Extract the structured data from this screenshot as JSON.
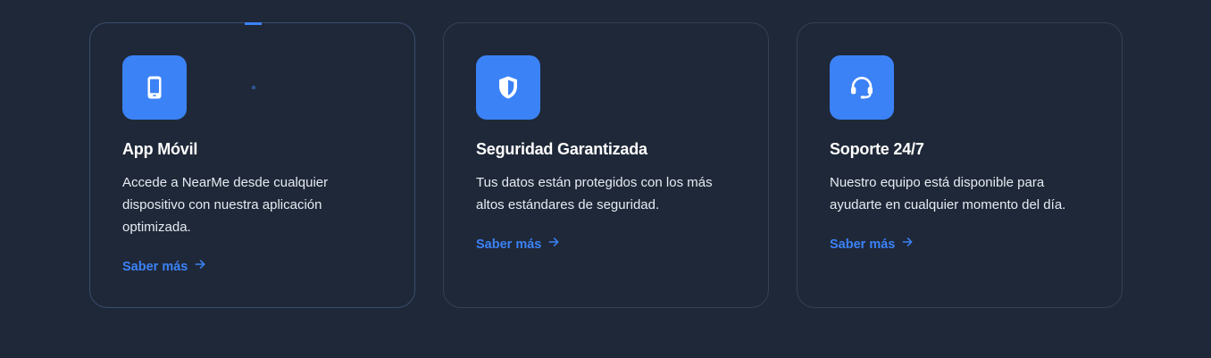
{
  "colors": {
    "background": "#1f2838",
    "accent": "#3b82f6",
    "card_border": "#334056",
    "title": "#ffffff",
    "text": "#e6ebf3"
  },
  "cards": [
    {
      "icon": "smartphone-icon",
      "title": "App Móvil",
      "description": "Accede a NearMe desde cualquier dispositivo con nuestra aplicación optimizada.",
      "link_label": "Saber más",
      "link_icon": "arrow-right-icon"
    },
    {
      "icon": "shield-icon",
      "title": "Seguridad Garantizada",
      "description": "Tus datos están protegidos con los más altos estándares de seguridad.",
      "link_label": "Saber más",
      "link_icon": "arrow-right-icon"
    },
    {
      "icon": "headset-icon",
      "title": "Soporte 24/7",
      "description": "Nuestro equipo está disponible para ayudarte en cualquier momento del día.",
      "link_label": "Saber más",
      "link_icon": "arrow-right-icon"
    }
  ]
}
